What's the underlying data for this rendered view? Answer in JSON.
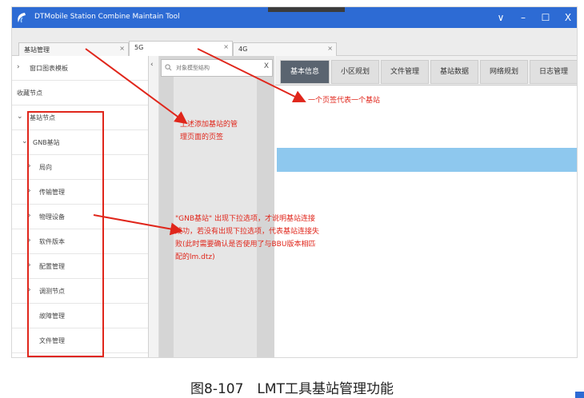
{
  "window": {
    "title": "DTMobile Station Combine Maintain Tool",
    "controls": [
      "∨",
      "–",
      "☐",
      "X"
    ]
  },
  "doc_tabs": [
    {
      "label": "基站管理",
      "close": "×"
    },
    {
      "label": "5G",
      "close": "×"
    },
    {
      "label": "4G",
      "close": "×"
    }
  ],
  "sidebar": {
    "window_template": "窗口图表模板",
    "favorites": "收藏节点",
    "station_node": "基站节点",
    "gnb": "GNB基站",
    "children": [
      "局向",
      "传输管理",
      "物理设备",
      "软件版本",
      "配置管理",
      "调测节点",
      "故障管理",
      "文件管理"
    ]
  },
  "search": {
    "placeholder": "对象模型结构",
    "clear": "X"
  },
  "collapse_arrow": "‹",
  "func_tabs": [
    "基本信息",
    "小区规划",
    "文件管理",
    "基站数据",
    "网络规划",
    "日志管理"
  ],
  "annotations": {
    "tab_meaning": "一个页签代表一个基站",
    "doc_tab_line1": "上述添加基站的管",
    "doc_tab_line2": "理页面的页签",
    "gnb_line1": "\"GNB基站\" 出现下拉选项，才说明基站连接",
    "gnb_line2": "成功，若没有出现下拉选项，代表基站连接失",
    "gnb_line3": "败(此时需要确认是否使用了与BBU版本相匹",
    "gnb_line4": "配的lm.dtz)"
  },
  "caption": "图8-107　LMT工具基站管理功能",
  "colors": {
    "titlebar": "#2d6bd4",
    "annotation": "#e0261b",
    "active_tab": "#5a6470",
    "selected_row": "#8ec8ee"
  }
}
